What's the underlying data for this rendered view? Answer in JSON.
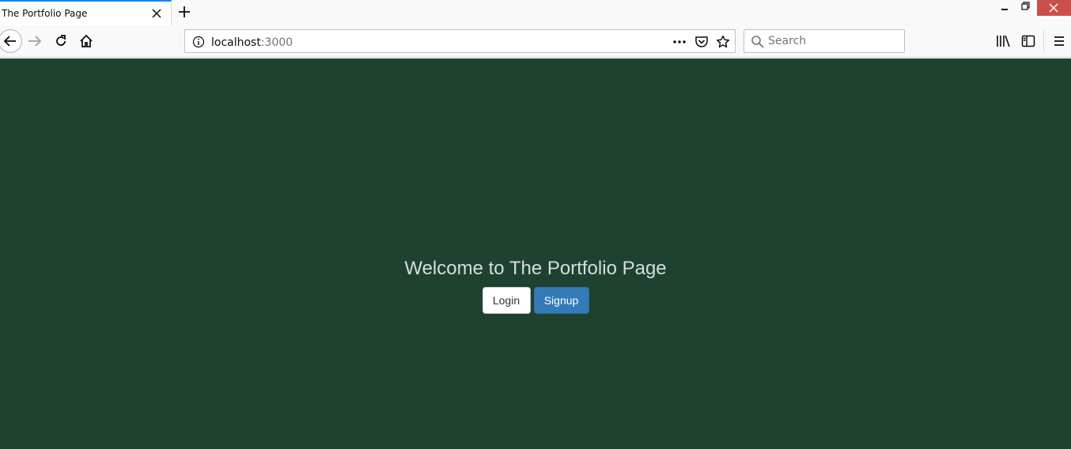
{
  "browser": {
    "tab": {
      "title": "The Portfolio Page"
    },
    "url": {
      "host": "localhost",
      "port": ":3000"
    },
    "search": {
      "placeholder": "Search"
    }
  },
  "page": {
    "background_color": "#1f4230",
    "heading": "Welcome to The Portfolio Page",
    "buttons": {
      "login_label": "Login",
      "signup_label": "Signup"
    }
  },
  "icons": [
    "close-icon",
    "plus-icon",
    "back-arrow-icon",
    "forward-arrow-icon",
    "reload-icon",
    "home-icon",
    "info-icon",
    "more-icon",
    "pocket-icon",
    "star-icon",
    "search-icon",
    "library-icon",
    "sidebar-icon",
    "hamburger-menu-icon"
  ]
}
